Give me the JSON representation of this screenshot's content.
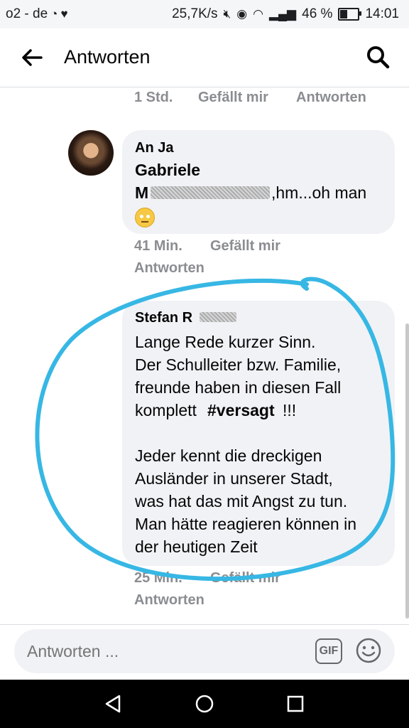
{
  "status_bar": {
    "carrier": "o2 - de",
    "speed": "25,7K/s",
    "battery": "46 %",
    "battery_level": 0.46,
    "time": "14:01"
  },
  "header": {
    "title": "Antworten"
  },
  "top_meta": {
    "time": "1 Std.",
    "like": "Gefällt mir",
    "reply": "Antworten"
  },
  "comment1": {
    "author": "An Ja",
    "mention_name": "Gabriele",
    "mention_initial": "M",
    "text": ",hm...oh man",
    "emoji": "face-with-rolling-eyes",
    "time": "41 Min.",
    "like": "Gefällt mir",
    "reply": "Antworten"
  },
  "comment2": {
    "author": "Stefan R",
    "lines": [
      "Lange Rede kurzer Sinn.",
      "Der Schulleiter bzw. Familie,",
      "freunde haben in diesen Fall",
      "komplett",
      "#versagt",
      " !!!",
      "Jeder kennt die dreckigen",
      "Ausländer in unserer Stadt,",
      "was hat das mit Angst zu tun.",
      "Man hätte reagieren können in",
      "der heutigen Zeit"
    ],
    "time": "25 Min.",
    "like": "Gefällt mir",
    "reply": "Antworten"
  },
  "reply_bar": {
    "placeholder": "Antworten ...",
    "gif_label": "GIF"
  },
  "colors": {
    "highlight": "#37b7e4",
    "bubble": "#f0f2f5",
    "meta": "#8a8d91"
  }
}
